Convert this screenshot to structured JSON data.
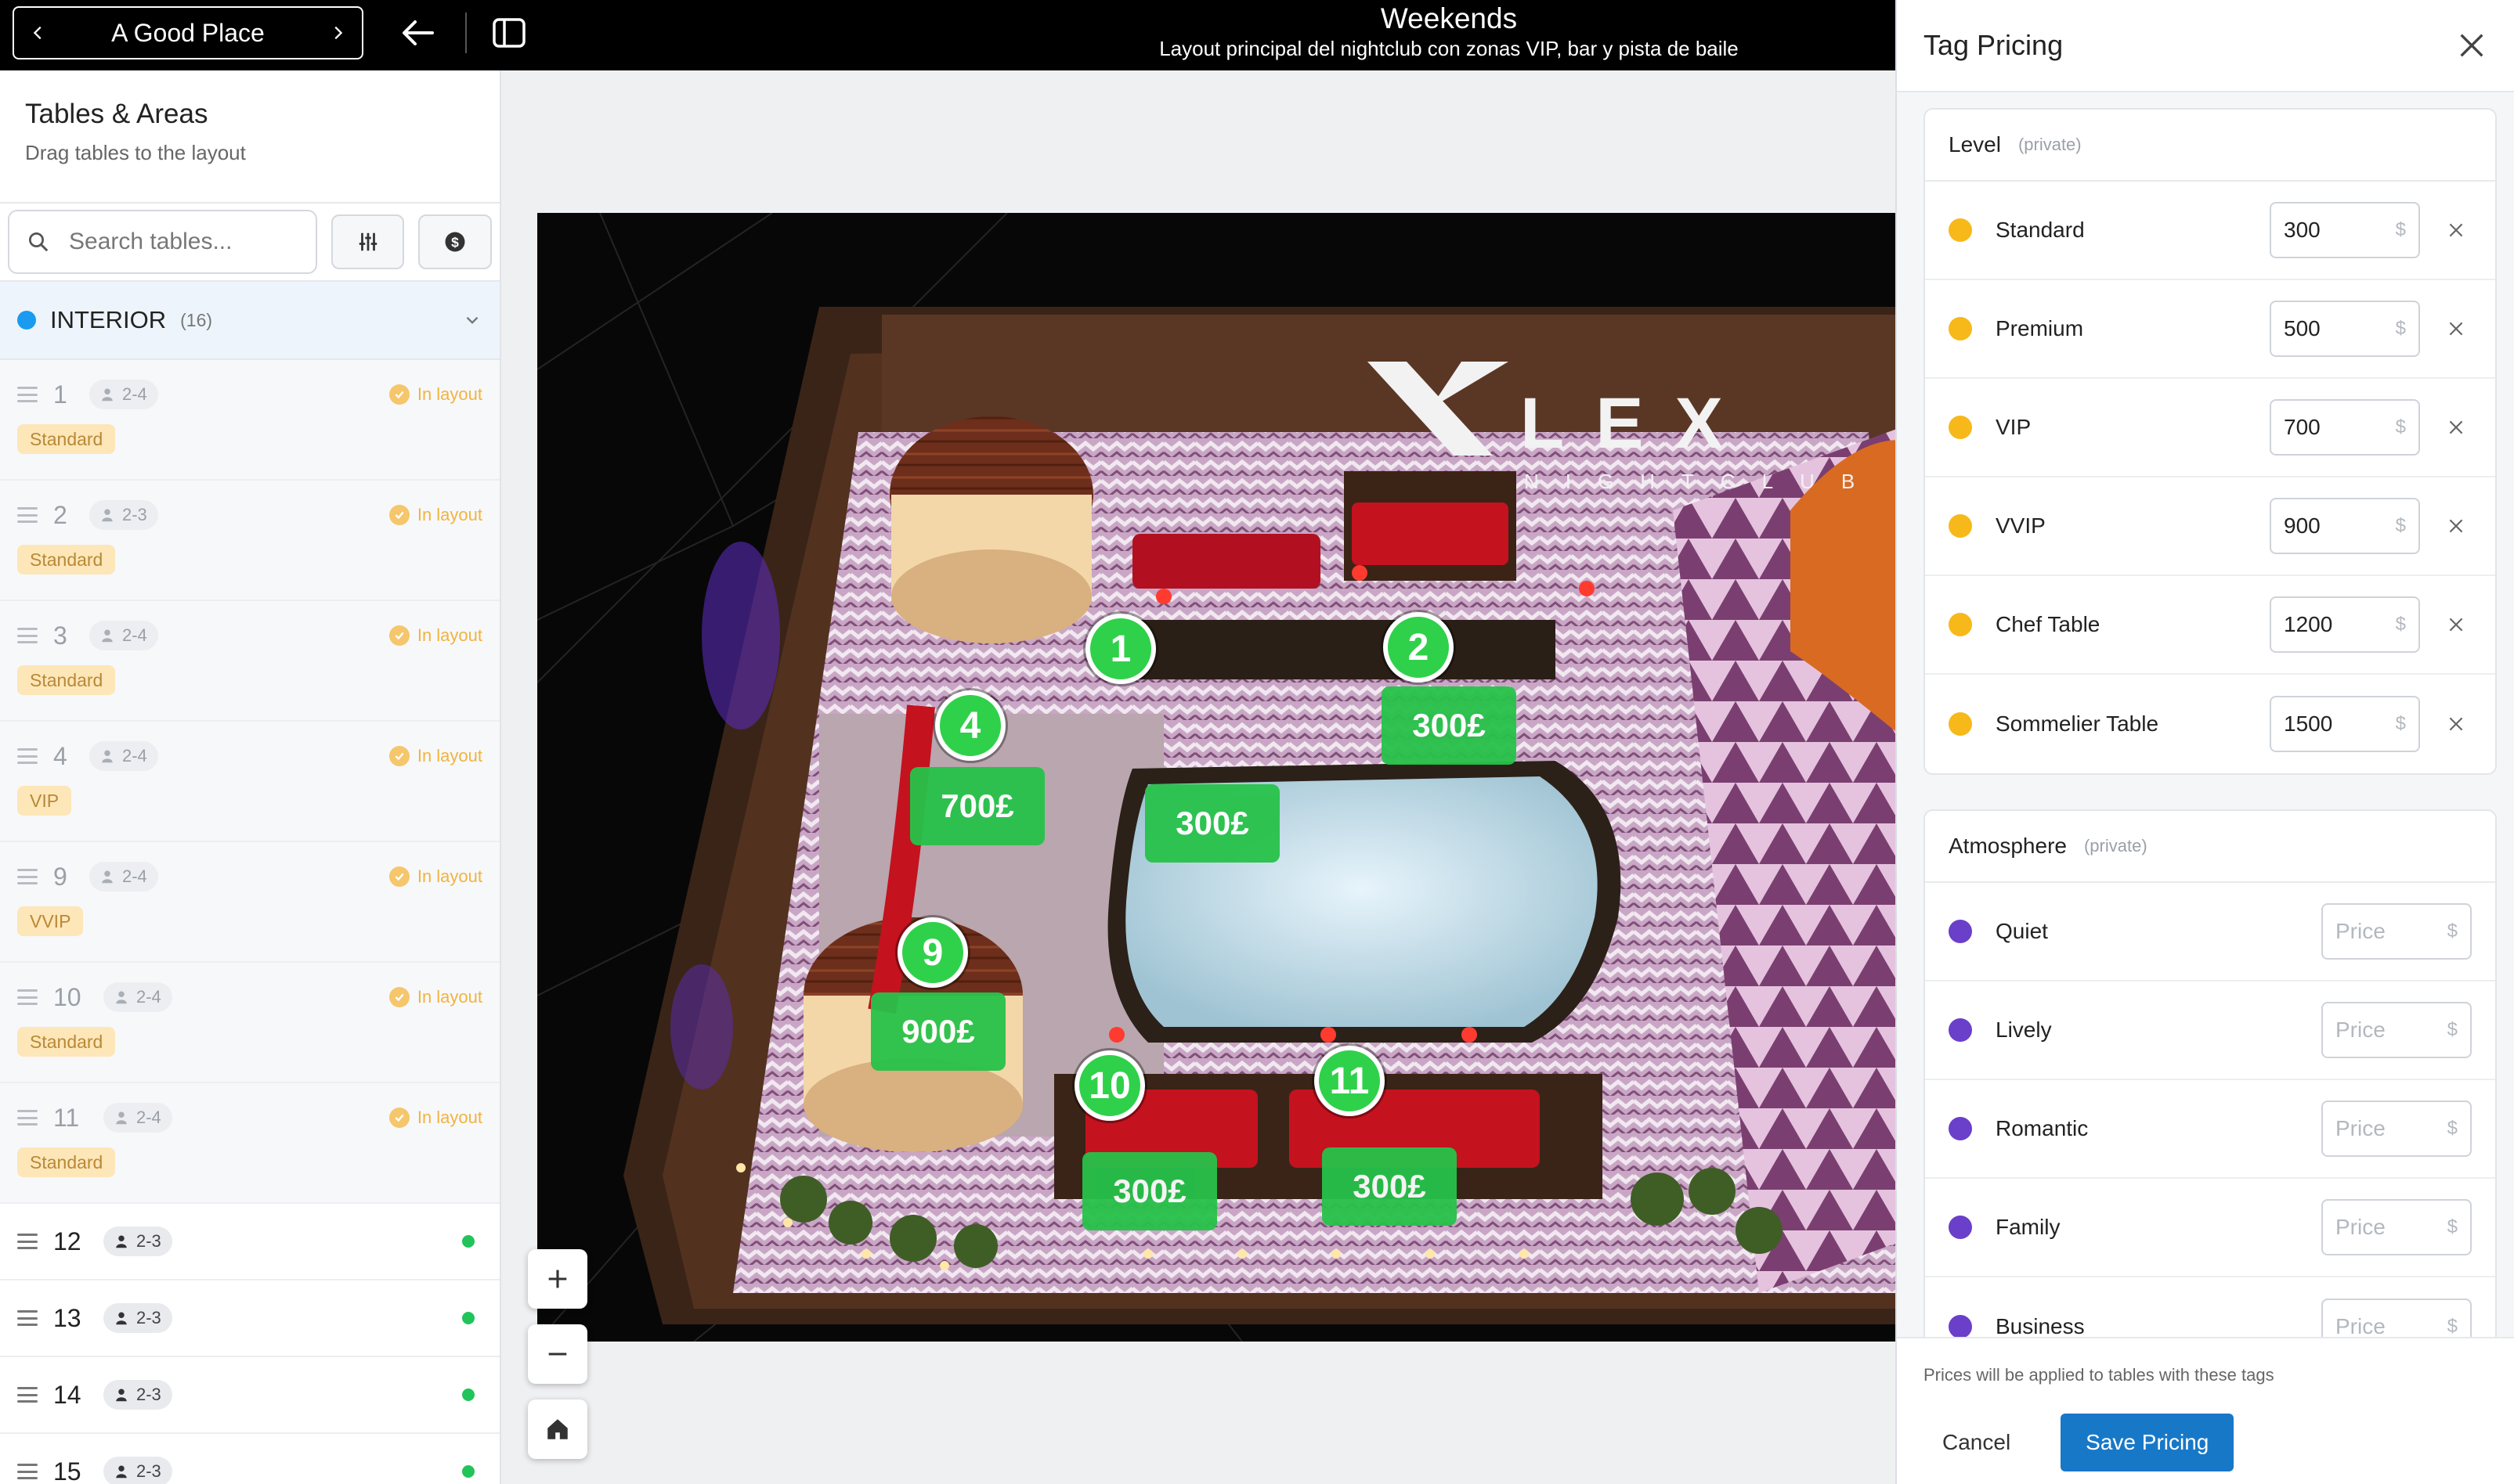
{
  "topbar": {
    "venue": "A Good Place",
    "title": "Weekends",
    "subtitle": "Layout principal del nightclub con zonas VIP, bar y pista de baile"
  },
  "sidebar": {
    "title": "Tables & Areas",
    "subtitle": "Drag tables to the layout",
    "search_placeholder": "Search tables...",
    "section": {
      "name": "INTERIOR",
      "count": "(16)"
    },
    "placed_rows": [
      {
        "num": "1",
        "cap": "2-4",
        "status": "In layout",
        "tag": "Standard"
      },
      {
        "num": "2",
        "cap": "2-3",
        "status": "In layout",
        "tag": "Standard"
      },
      {
        "num": "3",
        "cap": "2-4",
        "status": "In layout",
        "tag": "Standard"
      },
      {
        "num": "4",
        "cap": "2-4",
        "status": "In layout",
        "tag": "VIP"
      },
      {
        "num": "9",
        "cap": "2-4",
        "status": "In layout",
        "tag": "VVIP"
      },
      {
        "num": "10",
        "cap": "2-4",
        "status": "In layout",
        "tag": "Standard"
      },
      {
        "num": "11",
        "cap": "2-4",
        "status": "In layout",
        "tag": "Standard"
      }
    ],
    "unplaced_rows": [
      {
        "num": "12",
        "cap": "2-3"
      },
      {
        "num": "13",
        "cap": "2-3"
      },
      {
        "num": "14",
        "cap": "2-3"
      },
      {
        "num": "15",
        "cap": "2-3"
      }
    ]
  },
  "map": {
    "brand": "LEX",
    "brand_sub": "NIGHTCLUB",
    "pins": [
      "1",
      "2",
      "4",
      "9",
      "10",
      "11"
    ],
    "prices": [
      "300£",
      "300£",
      "700£",
      "900£",
      "300£",
      "300£"
    ]
  },
  "panel": {
    "title": "Tag Pricing",
    "level": {
      "name": "Level",
      "privacy": "(private)",
      "rows": [
        {
          "label": "Standard",
          "value": "300",
          "currency": "$"
        },
        {
          "label": "Premium",
          "value": "500",
          "currency": "$"
        },
        {
          "label": "VIP",
          "value": "700",
          "currency": "$"
        },
        {
          "label": "VVIP",
          "value": "900",
          "currency": "$"
        },
        {
          "label": "Chef Table",
          "value": "1200",
          "currency": "$"
        },
        {
          "label": "Sommelier Table",
          "value": "1500",
          "currency": "$"
        }
      ]
    },
    "atmosphere": {
      "name": "Atmosphere",
      "privacy": "(private)",
      "rows": [
        {
          "label": "Quiet",
          "placeholder": "Price",
          "currency": "$"
        },
        {
          "label": "Lively",
          "placeholder": "Price",
          "currency": "$"
        },
        {
          "label": "Romantic",
          "placeholder": "Price",
          "currency": "$"
        },
        {
          "label": "Family",
          "placeholder": "Price",
          "currency": "$"
        },
        {
          "label": "Business",
          "placeholder": "Price",
          "currency": "$"
        }
      ]
    },
    "footer_note": "Prices will be applied to tables with these tags",
    "cancel_label": "Cancel",
    "save_label": "Save Pricing"
  },
  "colors": {
    "level_dot": "#f7b81a",
    "atmosphere_dot": "#6a3fc9",
    "pin_green": "#2fd14a",
    "accent_blue": "#1878c8"
  }
}
